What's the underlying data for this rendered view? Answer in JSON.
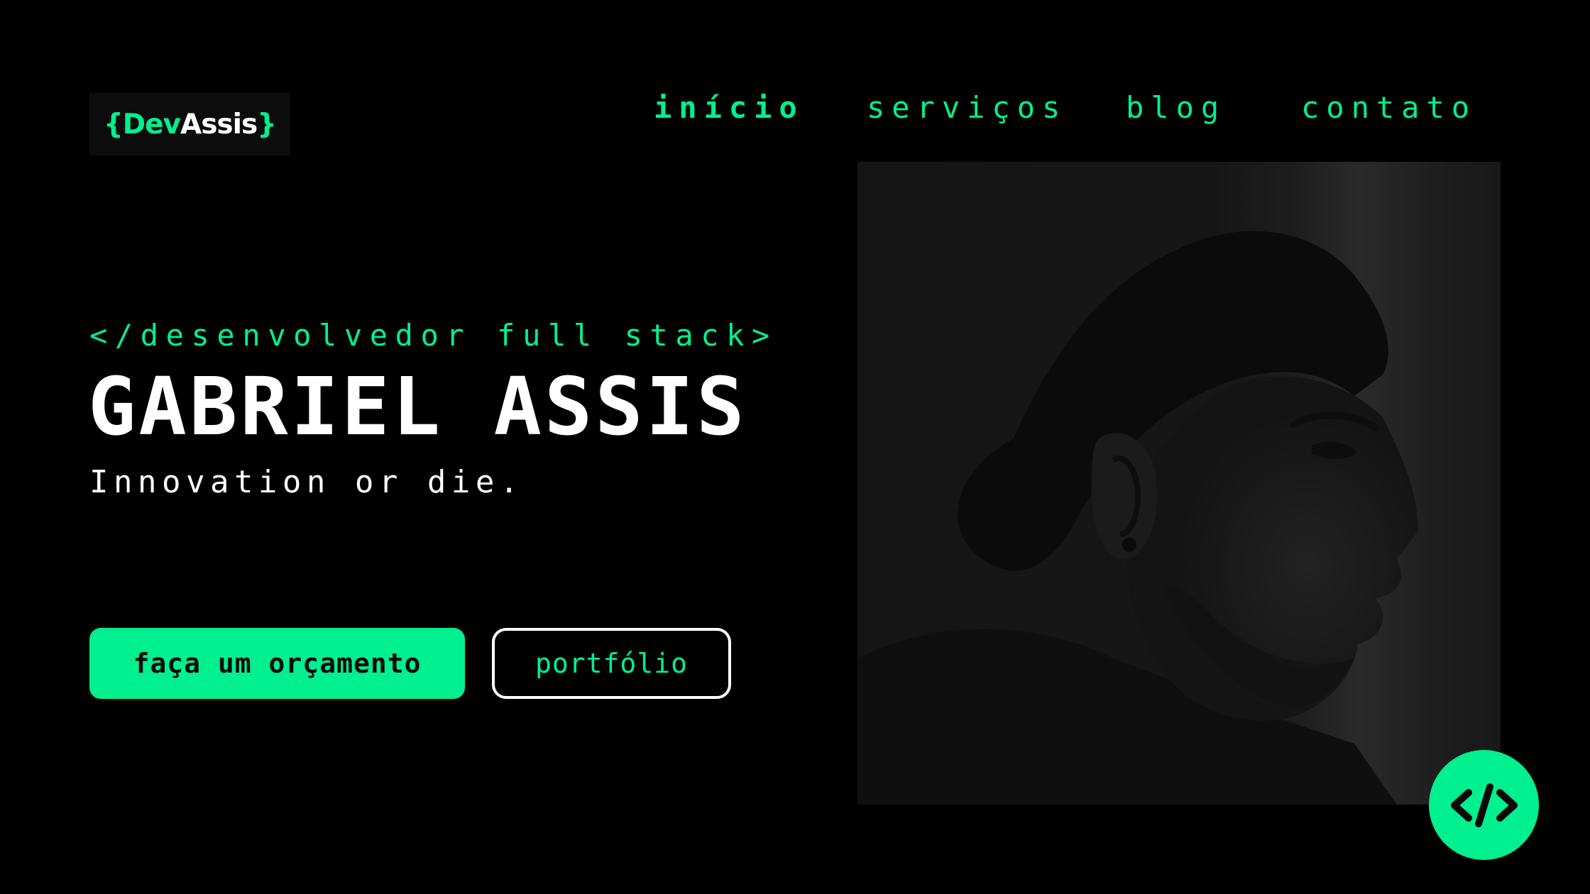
{
  "logo": {
    "open_brace": "{",
    "dev": "Dev",
    "assis": "Assis",
    "close_brace": "}"
  },
  "nav": {
    "items": [
      {
        "label": "início",
        "active": true
      },
      {
        "label": "serviços",
        "active": false
      },
      {
        "label": "blog",
        "active": false
      },
      {
        "label": "contato",
        "active": false
      }
    ]
  },
  "hero": {
    "subtitle": "</desenvolvedor full stack>",
    "name": "GABRIEL ASSIS",
    "tagline": "Innovation or die."
  },
  "buttons": {
    "primary_label": "faça um orçamento",
    "secondary_label": "portfólio"
  },
  "photo": {
    "icon": "portrait-photo"
  },
  "fab": {
    "icon": "code-icon"
  },
  "colors": {
    "accent": "#00f090",
    "background": "#000000",
    "text": "#ffffff"
  }
}
